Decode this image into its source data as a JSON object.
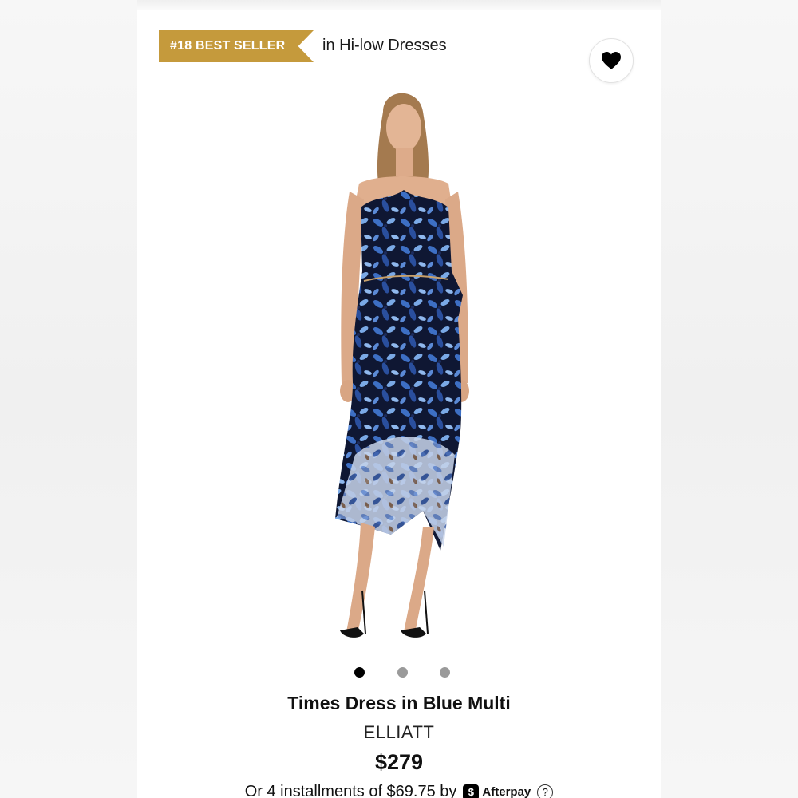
{
  "badge": {
    "label": "#18 BEST SELLER",
    "context": "in Hi-low Dresses",
    "color": "#c59a3c"
  },
  "favorite": {
    "icon": "heart-icon"
  },
  "gallery": {
    "image_count": 3,
    "active_index": 0
  },
  "product": {
    "title": "Times Dress in Blue Multi",
    "brand": "ELLIATT",
    "price": "$279"
  },
  "payment": {
    "installments_text": "Or 4 installments of $69.75 by",
    "provider": "Afterpay",
    "provider_mark": "$",
    "help": "?"
  }
}
